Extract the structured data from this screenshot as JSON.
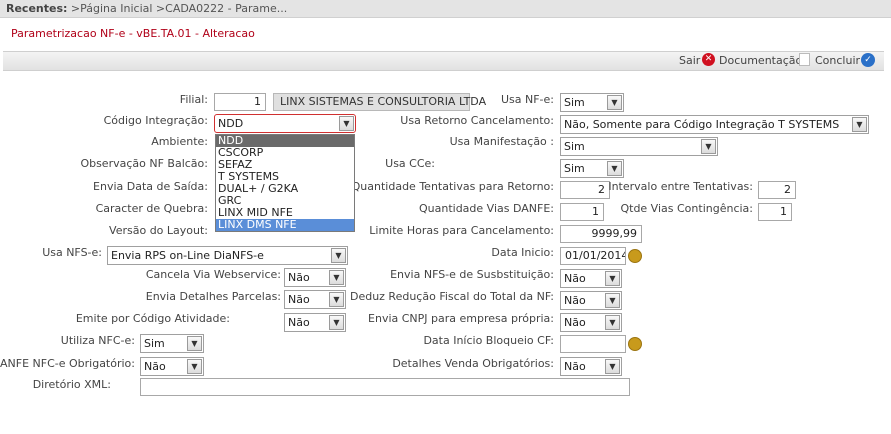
{
  "recentes": {
    "label": "Recentes:",
    "path": ">Página Inicial >CADA0222 - Parame..."
  },
  "title": "Parametrizacao NF-e - vBE.TA.01 - Alteracao",
  "actions": {
    "sair": "Sair",
    "documentacao": "Documentação",
    "concluir": "Concluir"
  },
  "form": {
    "filial": {
      "label": "Filial:",
      "value": "1",
      "name": "LINX SISTEMAS E CONSULTORIA LTDA"
    },
    "codigo_integracao": {
      "label": "Código Integração:",
      "value": "NDD",
      "options": [
        "NDD",
        "CSCORP",
        "SEFAZ",
        "T SYSTEMS",
        "DUAL+ / G2KA",
        "GRC",
        "LINX MID NFE",
        "LINX DMS NFE"
      ]
    },
    "ambiente": {
      "label": "Ambiente:"
    },
    "observacao_nf_balcao": {
      "label": "Observação NF Balcão:"
    },
    "envia_data_saida": {
      "label": "Envia Data de Saída:"
    },
    "caracter_quebra": {
      "label": "Caracter de Quebra:"
    },
    "versao_layout": {
      "label": "Versão do Layout:"
    },
    "usa_nfe": {
      "label": "Usa NF-e:",
      "value": "Sim"
    },
    "usa_retorno_cancelamento": {
      "label": "Usa Retorno Cancelamento:",
      "value": "Não, Somente para Código Integração T SYSTEMS"
    },
    "usa_manifestacao": {
      "label": "Usa Manifestação :",
      "value": "Sim"
    },
    "usa_cce": {
      "label": "Usa CCe:",
      "value": "Sim"
    },
    "qtd_tentativas_retorno": {
      "label": "Quantidade Tentativas para Retorno:",
      "value": "2"
    },
    "intervalo_tentativas": {
      "label": "Intervalo entre Tentativas:",
      "value": "2"
    },
    "qtd_vias_danfe": {
      "label": "Quantidade Vias DANFE:",
      "value": "1"
    },
    "qtde_vias_contingencia": {
      "label": "Qtde Vias Contingência:",
      "value": "1"
    },
    "limite_horas_cancelamento": {
      "label": "Limite Horas para Cancelamento:",
      "value": "9999,99"
    },
    "usa_nfse": {
      "label": "Usa NFS-e:",
      "value": "Envia RPS on-Line DiaNFS-e"
    },
    "data_inicio": {
      "label": "Data Inicio:",
      "value": "01/01/2014"
    },
    "cancela_via_webservice": {
      "label": "Cancela Via Webservice:",
      "value": "Não"
    },
    "envia_detalhes_parcelas": {
      "label": "Envia Detalhes Parcelas:",
      "value": "Não"
    },
    "emite_por_codigo_atividade": {
      "label": "Emite por Código Atividade:",
      "value": "Não"
    },
    "envia_nfse_substituicao": {
      "label": "Envia NFS-e de Susbstituição:",
      "value": "Não"
    },
    "deduz_reducao_fiscal": {
      "label": "Deduz Redução Fiscal do Total da NF:",
      "value": "Não"
    },
    "envia_cnpj_empresa_propria": {
      "label": "Envia CNPJ para empresa própria:",
      "value": "Não"
    },
    "utiliza_nfce": {
      "label": "Utiliza NFC-e:",
      "value": "Sim"
    },
    "danfe_nfce_obrigatorio": {
      "label": "DANFE NFC-e Obrigatório:",
      "value": "Não"
    },
    "data_inicio_bloqueio_cf": {
      "label": "Data Início Bloqueio CF:",
      "value": ""
    },
    "detalhes_venda_obrigatorios": {
      "label": "Detalhes Venda Obrigatórios:",
      "value": "Não"
    },
    "diretorio_xml": {
      "label": "Diretório XML:",
      "value": ""
    }
  },
  "icons": {
    "sair": "close-red-icon",
    "documentacao": "document-icon",
    "concluir": "check-circle-icon",
    "calendar": "calendar-icon",
    "dropdown": "chevron-down-icon"
  },
  "colors": {
    "title": "#b00018",
    "dropdown_current": "#6a6a6a",
    "dropdown_highlight": "#5a8ed8"
  }
}
